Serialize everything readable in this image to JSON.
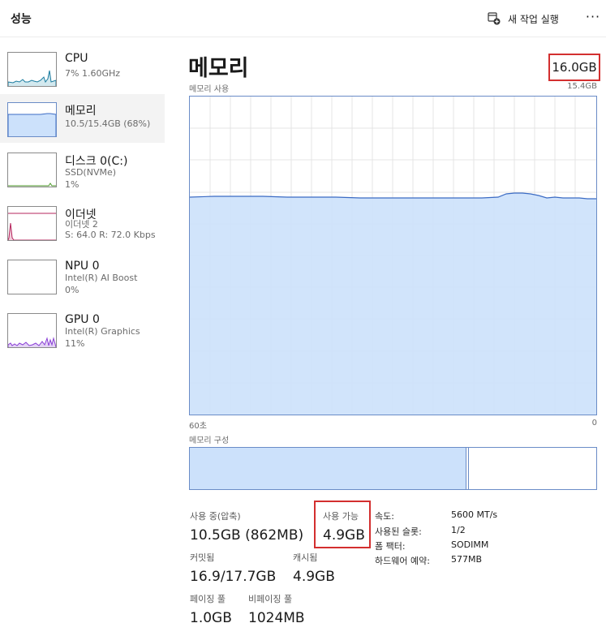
{
  "header": {
    "title": "성능",
    "run_task_label": "새 작업 실행",
    "more_label": "···"
  },
  "sidebar": {
    "items": [
      {
        "name": "CPU",
        "sub1": "7% 1.60GHz",
        "sub2": "",
        "sub3": "",
        "selected": false,
        "color": "#1b7ca0"
      },
      {
        "name": "메모리",
        "sub1": "10.5/15.4GB (68%)",
        "sub2": "",
        "sub3": "",
        "selected": true,
        "color": "#3b6bc4"
      },
      {
        "name": "디스크 0(C:)",
        "sub1": "SSD(NVMe)",
        "sub2": "1%",
        "sub3": "",
        "selected": false,
        "color": "#4c9a2a"
      },
      {
        "name": "이더넷",
        "sub1": "이더넷 2",
        "sub2": "S: 64.0 R: 72.0 Kbps",
        "sub3": "",
        "selected": false,
        "color": "#b5245c"
      },
      {
        "name": "NPU 0",
        "sub1": "Intel(R) AI Boost",
        "sub2": "0%",
        "sub3": "",
        "selected": false,
        "color": "#1b7ca0"
      },
      {
        "name": "GPU 0",
        "sub1": "Intel(R) Graphics",
        "sub2": "11%",
        "sub3": "",
        "selected": false,
        "color": "#8a3fd6"
      }
    ]
  },
  "main": {
    "title": "메모리",
    "total": "16.0GB",
    "usage_label": "메모리 사용",
    "usage_max": "15.4GB",
    "time_start": "60초",
    "time_end": "0",
    "composition_label": "메모리 구성",
    "composition_used_fraction": 0.68
  },
  "stats": {
    "in_use_label": "사용 중(압축)",
    "in_use_value": "10.5GB (862MB)",
    "available_label": "사용 가능",
    "available_value": "4.9GB",
    "committed_label": "커밋됨",
    "committed_value": "16.9/17.7GB",
    "cached_label": "캐시됨",
    "cached_value": "4.9GB",
    "paged_pool_label": "페이징 풀",
    "paged_pool_value": "1.0GB",
    "nonpaged_pool_label": "비페이징 풀",
    "nonpaged_pool_value": "1024MB"
  },
  "specs": [
    {
      "label": "속도:",
      "value": "5600 MT/s"
    },
    {
      "label": "사용된 슬롯:",
      "value": "1/2"
    },
    {
      "label": "폼 팩터:",
      "value": "SODIMM"
    },
    {
      "label": "하드웨어 예약:",
      "value": "577MB"
    }
  ],
  "colors": {
    "accent": "#3b6bc4",
    "fill": "#cce1fb",
    "highlight": "#d32f2f"
  }
}
